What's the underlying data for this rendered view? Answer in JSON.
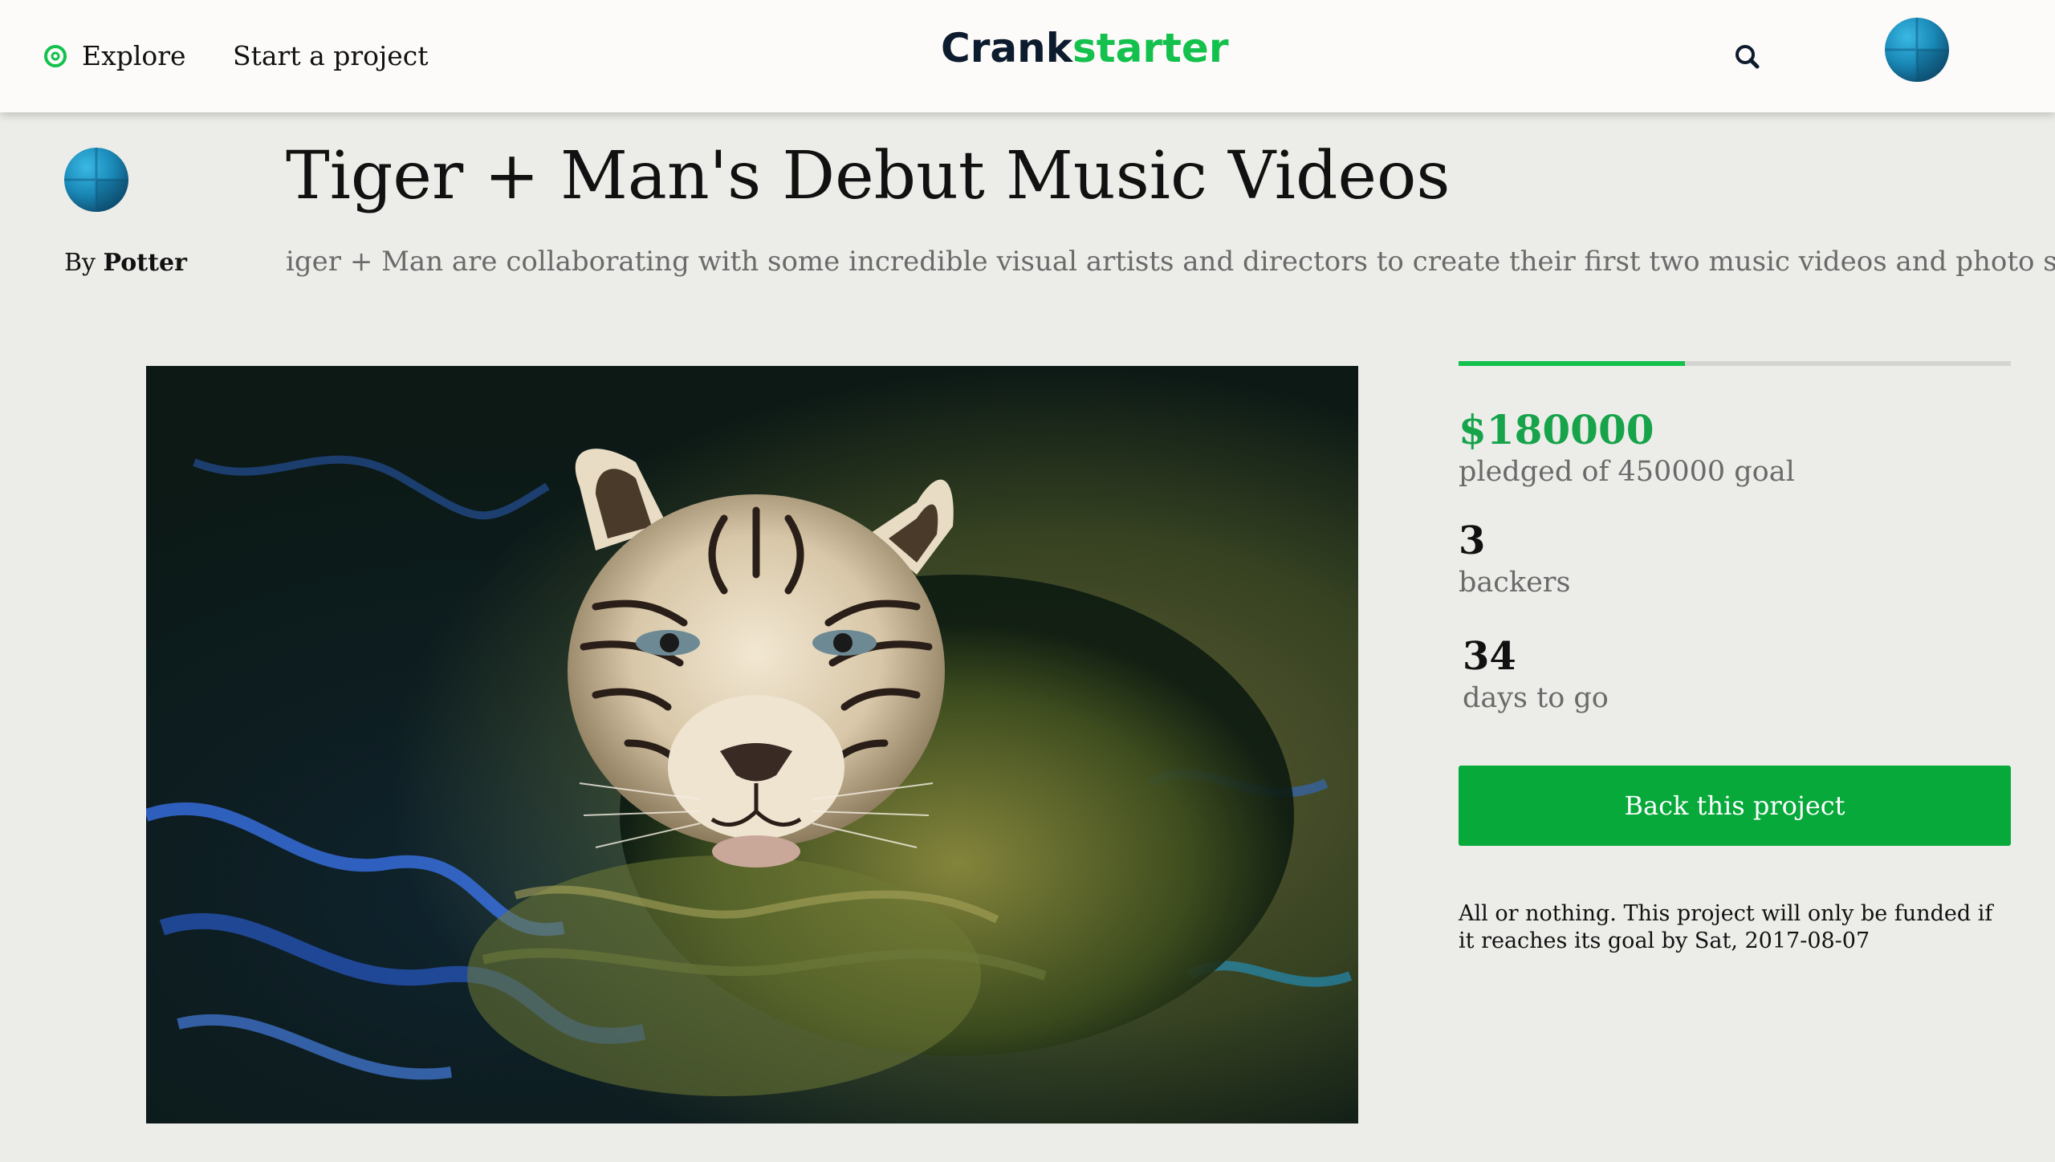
{
  "header": {
    "explore_label": "Explore",
    "start_project_label": "Start a project",
    "logo_part1": "Crank",
    "logo_part2": "starter",
    "search_icon": "search-icon",
    "compass_icon": "compass-icon"
  },
  "project": {
    "title": "Tiger + Man's Debut Music Videos",
    "blurb": "iger + Man are collaborating with some incredible visual artists and directors to create their first two music videos and photo shoot!",
    "by_prefix": "By",
    "creator_name": "Potter",
    "hero_image": "tiger swimming in water"
  },
  "stats": {
    "pledged": "$180000",
    "pledged_label": "pledged of 450000 goal",
    "pledged_amount": 180000,
    "goal_amount": 450000,
    "progress_fraction": 0.41,
    "backers": "3",
    "backers_label": "backers",
    "days": "34",
    "days_label": "days to go"
  },
  "cta": {
    "back_label": "Back this project",
    "funding_note": "All or nothing. This project will only be funded if it reaches its goal by Sat, 2017-08-07"
  },
  "colors": {
    "brand_dark": "#0d1b2e",
    "brand_green": "#14c14d",
    "button_green": "#06a93a",
    "pledged_green": "#16a34a",
    "page_bg": "#ecede8"
  }
}
